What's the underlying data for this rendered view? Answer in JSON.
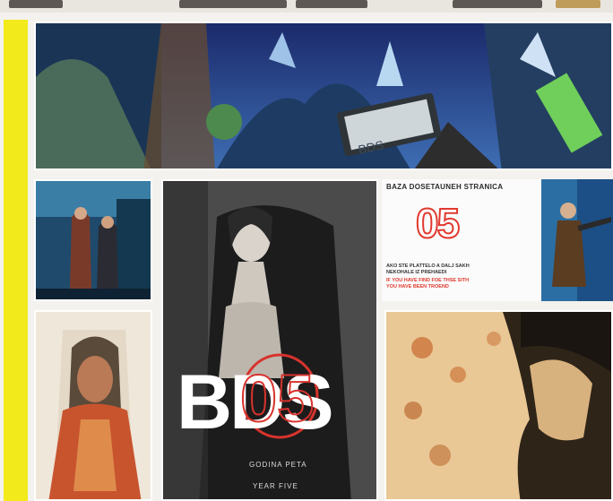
{
  "header": {
    "strip_description_blocks": 5
  },
  "banner": {
    "device_label": "BDS"
  },
  "promo": {
    "title": "BAZA DOSETAUNEH STRANICA",
    "number": "05",
    "line1": "AKO STE PLATTELO A DALJ SAKH",
    "line2": "NEKOHALE IZ PREHAEDI",
    "line3": "IF YOU HAVE FIND FOE THSE SITH",
    "line4": "YOU HAVE BEEN TROEND"
  },
  "cover": {
    "logo": "BDS",
    "number_overlay": "05",
    "subtitle": "GODINA PETA",
    "subtitle2": "YEAR FIVE"
  },
  "colors": {
    "accent_yellow": "#f2ea1a",
    "accent_red": "#e0392e"
  }
}
